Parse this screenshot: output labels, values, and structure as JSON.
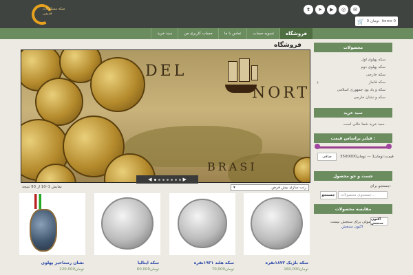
{
  "header": {
    "logo_text_1": "سکه مسکوکات",
    "logo_text_2": "قدیمی",
    "social": [
      {
        "icon": "twitter-icon",
        "glyph": "t"
      },
      {
        "icon": "telegram-icon",
        "glyph": "➤"
      },
      {
        "icon": "youtube-icon",
        "glyph": "▶"
      },
      {
        "icon": "instagram-icon",
        "glyph": "◎"
      },
      {
        "icon": "email-icon",
        "glyph": "✉"
      }
    ],
    "cart": {
      "price": "0 تومان",
      "items": "items 0"
    }
  },
  "nav": {
    "items": [
      {
        "label": "فروشگاه",
        "active": true
      },
      {
        "label": "تسویه حساب",
        "active": false
      },
      {
        "label": "تماس با ما",
        "active": false
      },
      {
        "label": "حساب کاربری من",
        "active": false
      },
      {
        "label": "سبد خرید",
        "active": false
      }
    ]
  },
  "main": {
    "title": "فروشگاه",
    "slider": {
      "words": [
        "DEL",
        "NORT",
        "BRASI"
      ]
    },
    "showing": "نمایش 1–10 از 93 نتیجه",
    "sort": {
      "selected": "رتب سازی بیش فرض"
    },
    "products": [
      {
        "name": "سکه بلژیک ۱۸۷۳نقره",
        "price": "160,000تومان"
      },
      {
        "name": "سکه هلند ۱۹۳۱نقره",
        "price": "70,000تومان"
      },
      {
        "name": "سکه ایتالیا",
        "price": "60,000تومان"
      },
      {
        "name": "نشان رستاخیز پهلوی",
        "price": "220,000تومان"
      }
    ]
  },
  "sidebar": {
    "products": {
      "title": "محصولات",
      "items": [
        "سکه پهلوی اول",
        "سکه پهلوی دوم",
        "سکه خارجی",
        "سکه قاجار",
        "سکه و یاد بود جمهوری اسلامی",
        "سکه و نشان خارجی"
      ]
    },
    "cart": {
      "title": "سبد خرید",
      "text": "سبد خرید شما خالی است."
    },
    "price_filter": {
      "title": "فیلتر براساس قیمت :",
      "range_text": "قیمت:تومان1 — تومان3500000",
      "button": "صافی"
    },
    "search": {
      "title": "جست و جو محصول",
      "label": "جستجو برای:",
      "placeholder": "جستجوی محصولات...",
      "button": "جستجو"
    },
    "compare": {
      "title": "مقایسه محصولات",
      "text": "محصولی برای سنجش نیست",
      "link": "اکنون سنجش"
    }
  }
}
